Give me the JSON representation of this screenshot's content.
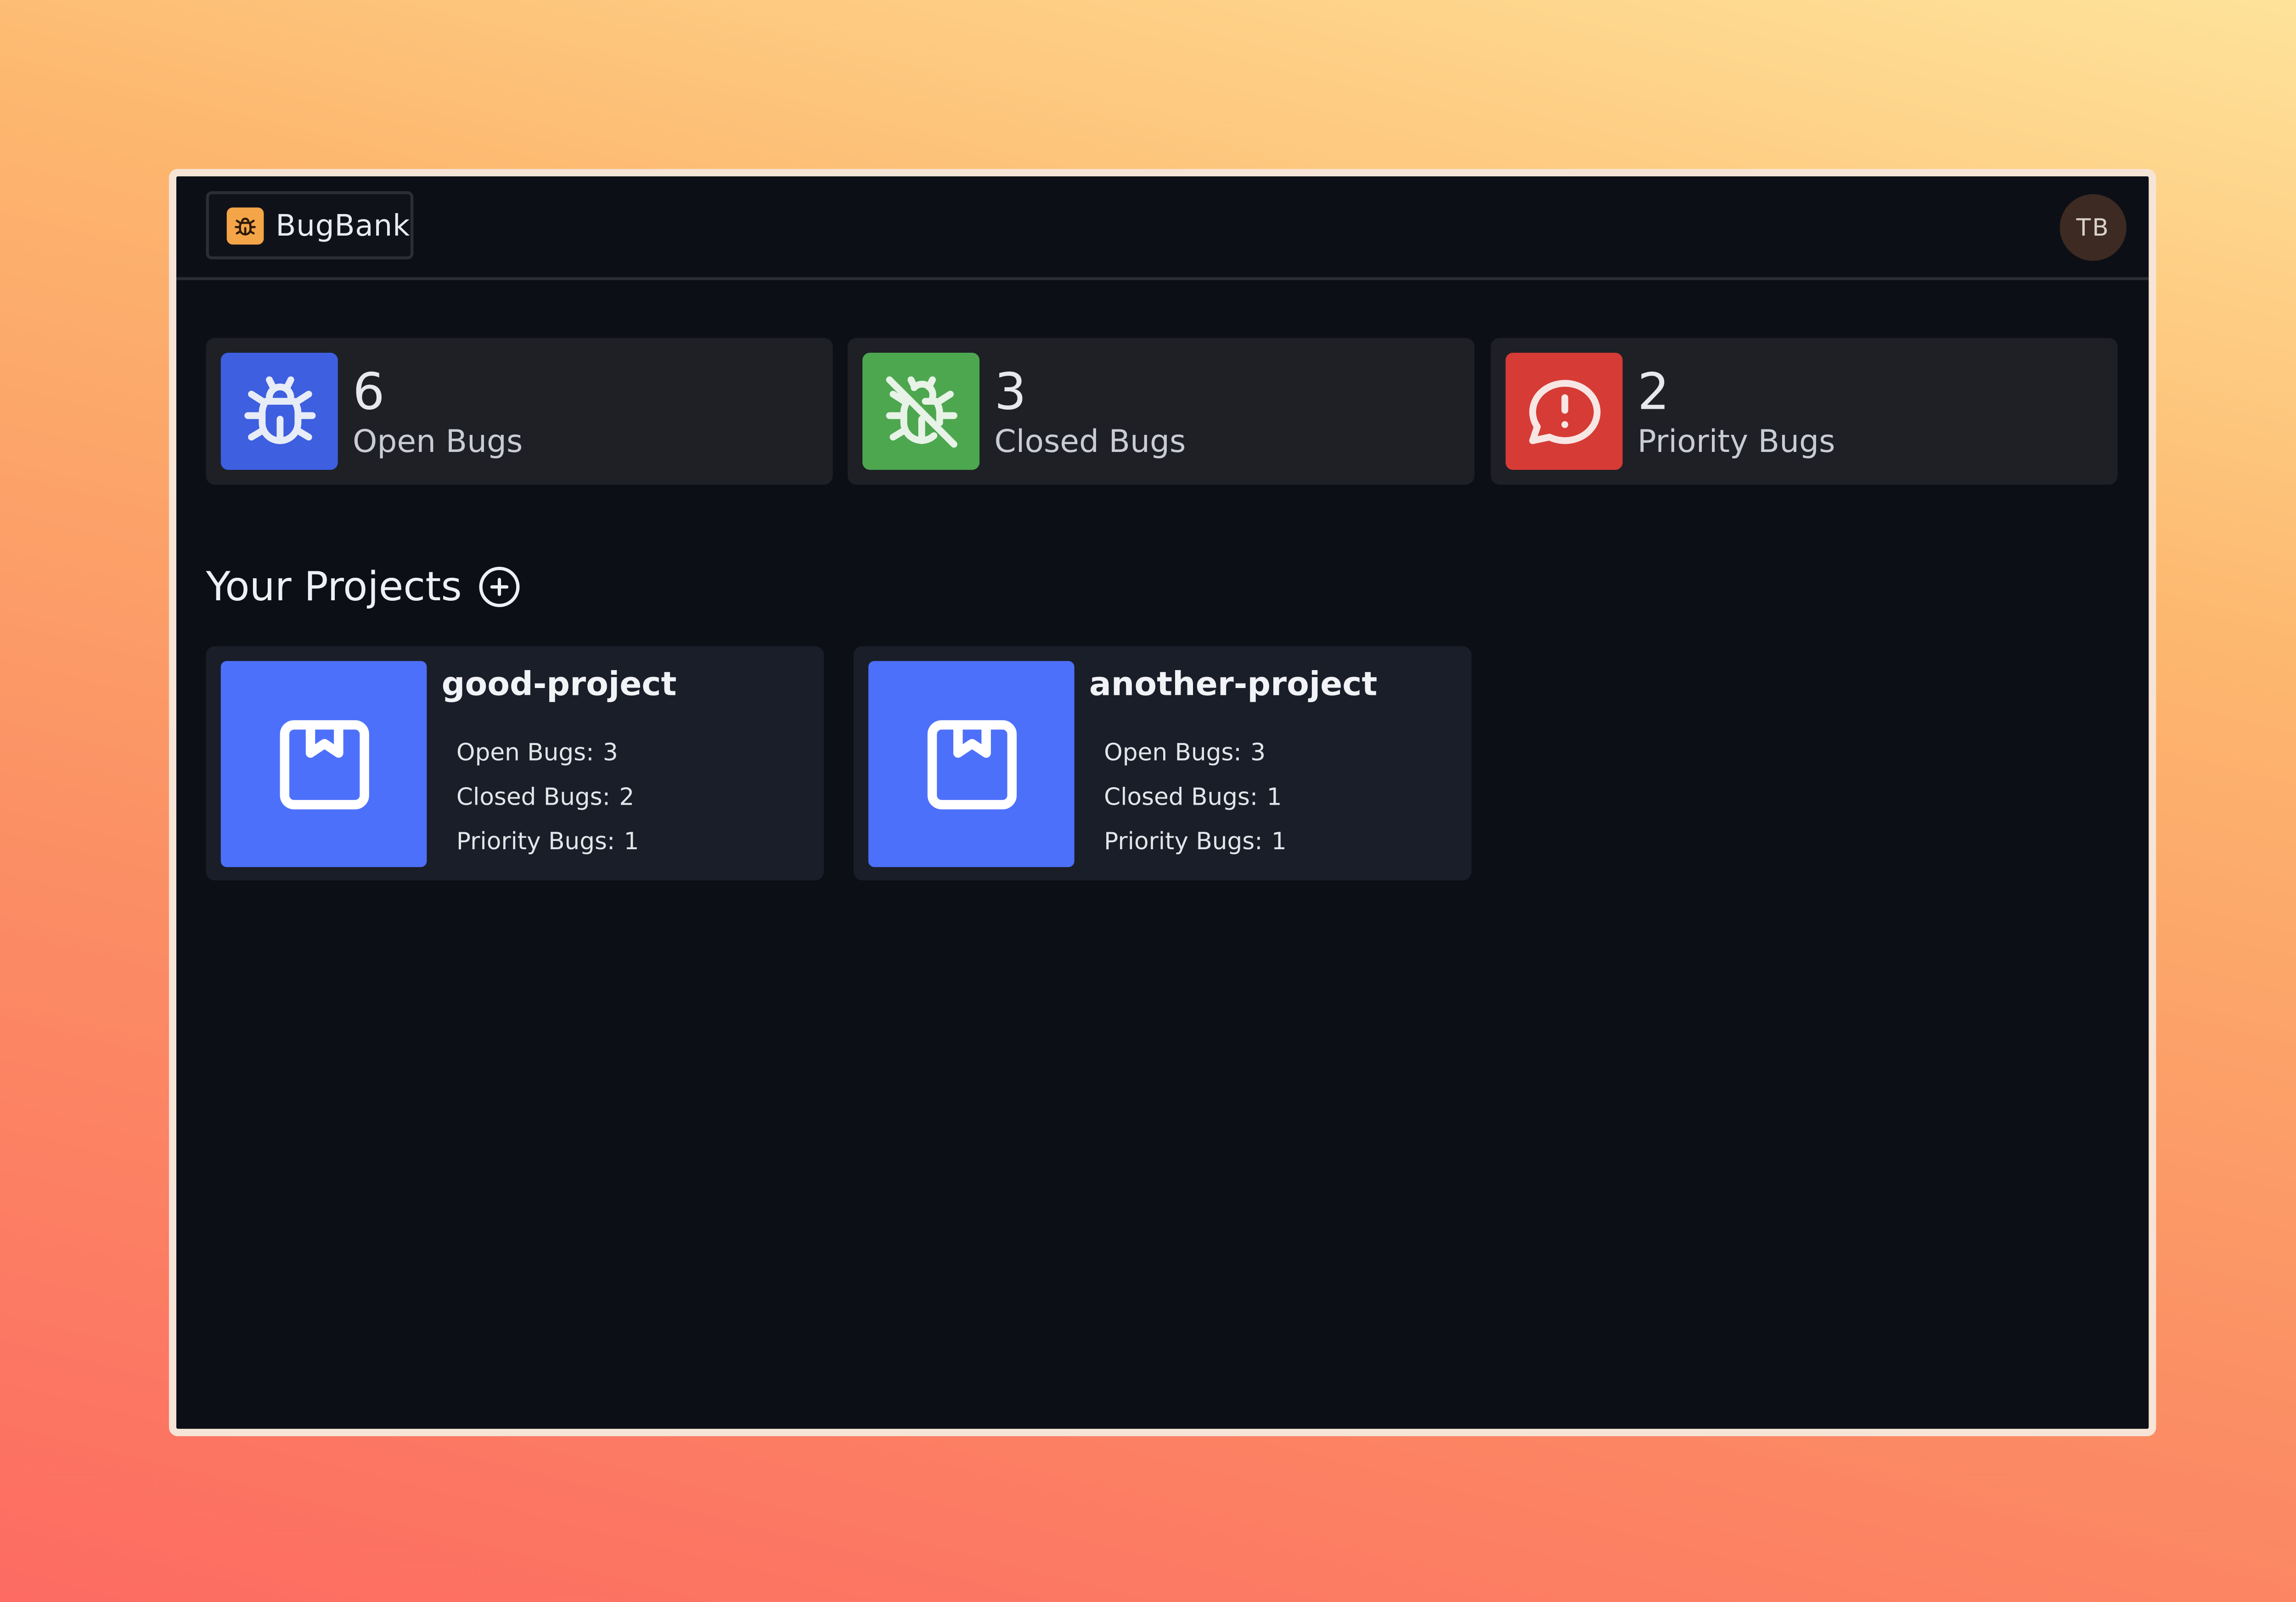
{
  "app": {
    "name": "BugBank",
    "logo_icon": "bug-icon",
    "logo_color": "#f4a548"
  },
  "user": {
    "initials": "TB"
  },
  "stats": [
    {
      "value": "6",
      "label": "Open Bugs",
      "icon": "bug-icon",
      "color": "#3d5fe0"
    },
    {
      "value": "3",
      "label": "Closed Bugs",
      "icon": "bug-off-icon",
      "color": "#4da74f"
    },
    {
      "value": "2",
      "label": "Priority Bugs",
      "icon": "alert-message-icon",
      "color": "#d63b35"
    }
  ],
  "projects_section": {
    "title": "Your Projects",
    "add_icon": "plus-circle-icon"
  },
  "projects": [
    {
      "name": "good-project",
      "icon": "bookmark-box-icon",
      "open_label": "Open Bugs:",
      "open": "3",
      "closed_label": "Closed Bugs:",
      "closed": "2",
      "priority_label": "Priority Bugs:",
      "priority": "1"
    },
    {
      "name": "another-project",
      "icon": "bookmark-box-icon",
      "open_label": "Open Bugs:",
      "open": "3",
      "closed_label": "Closed Bugs:",
      "closed": "1",
      "priority_label": "Priority Bugs:",
      "priority": "1"
    }
  ]
}
